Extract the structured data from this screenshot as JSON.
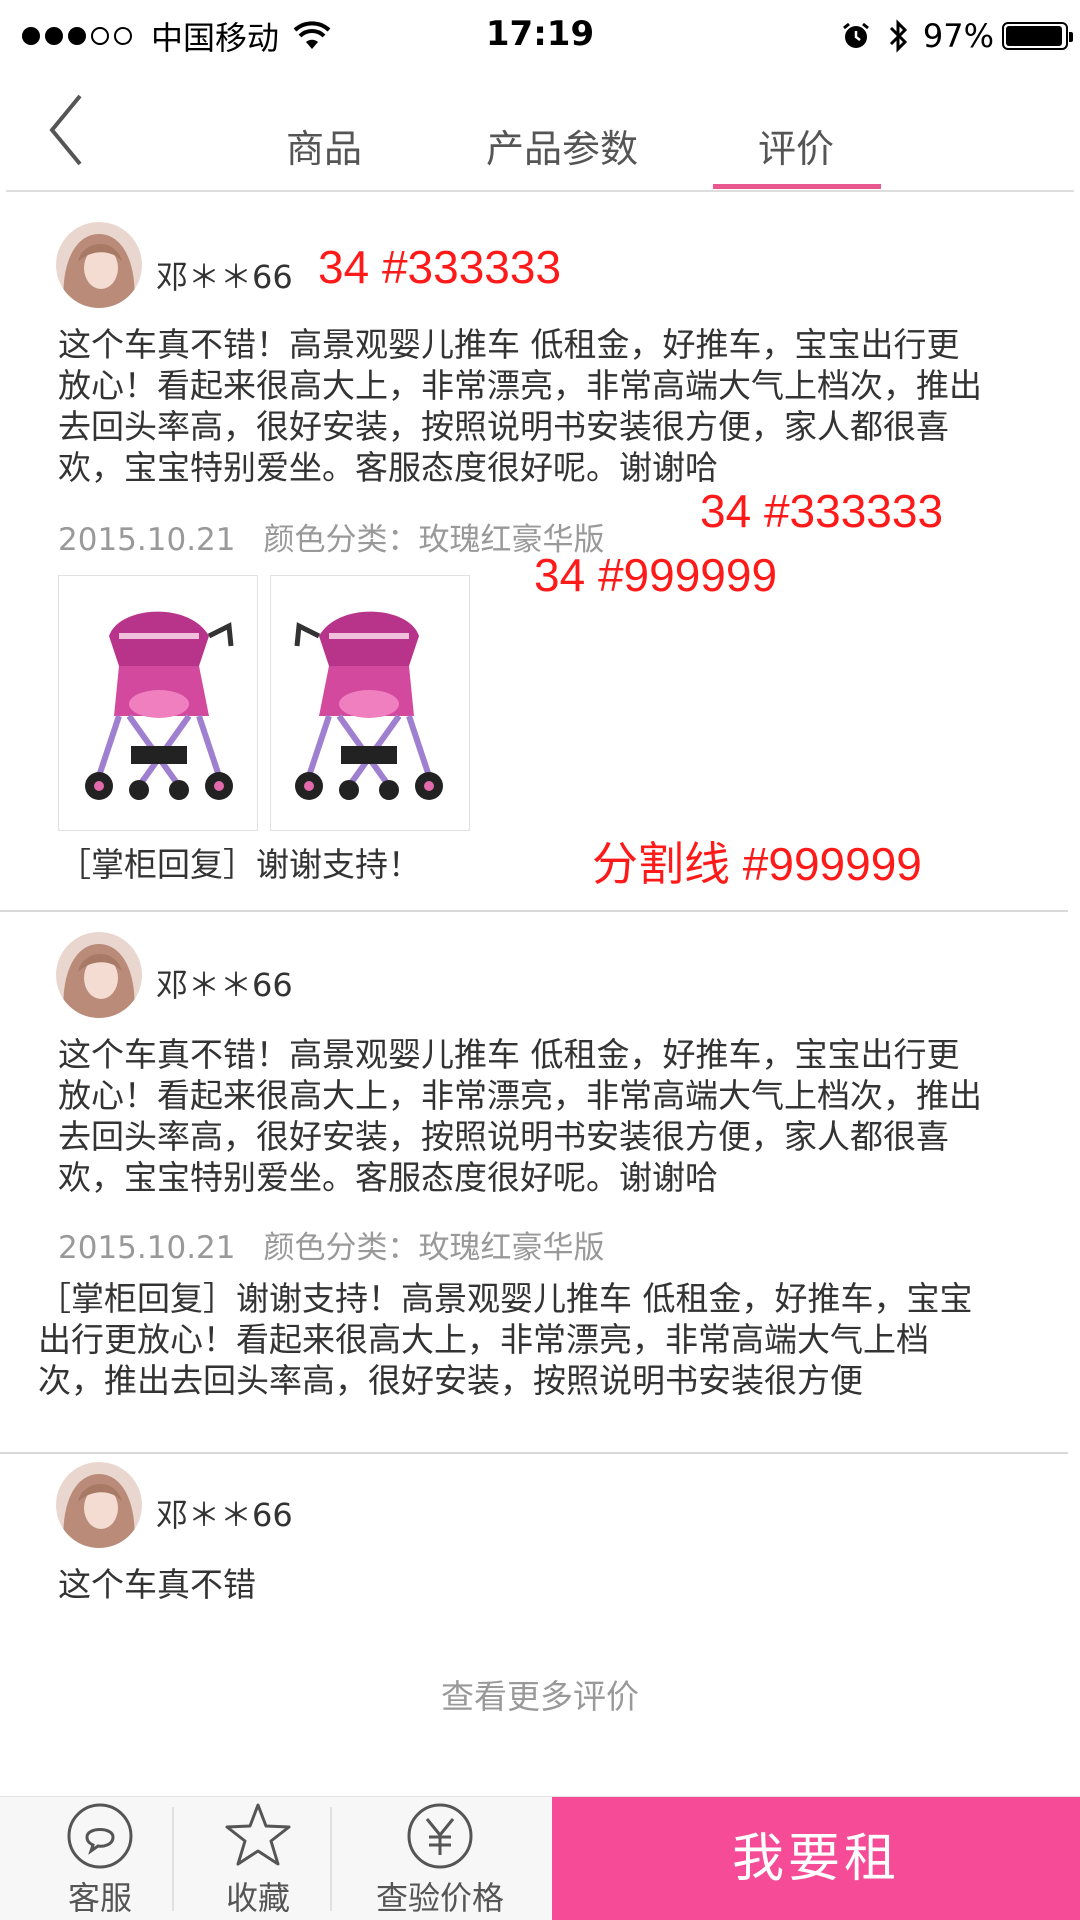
{
  "status_bar": {
    "carrier": "中国移动",
    "time": "17:19",
    "battery": "97%",
    "battery_level": 0.97
  },
  "nav": {
    "tabs": [
      {
        "label": "商品"
      },
      {
        "label": "产品参数"
      },
      {
        "label": "评价",
        "active": true
      }
    ],
    "accent_color": "#e8588e"
  },
  "reviews": [
    {
      "username": "邓＊＊66",
      "text": "这个车真不错！高景观婴儿推车 低租金，好推车，宝宝出行更放心！看起来很高大上，非常漂亮，非常高端大气上档次，推出去回头率高，很好安装，按照说明书安装很方便，家人都很喜欢，宝宝特别爱坐。客服态度很好呢。谢谢哈",
      "date": "2015.10.21",
      "variant": "颜色分类：玫瑰红豪华版",
      "reply": "［掌柜回复］谢谢支持！"
    },
    {
      "username": "邓＊＊66",
      "text": "这个车真不错！高景观婴儿推车 低租金，好推车，宝宝出行更放心！看起来很高大上，非常漂亮，非常高端大气上档次，推出去回头率高，很好安装，按照说明书安装很方便，家人都很喜欢，宝宝特别爱坐。客服态度很好呢。谢谢哈",
      "date": "2015.10.21",
      "variant": "颜色分类：玫瑰红豪华版",
      "reply": "［掌柜回复］谢谢支持！高景观婴儿推车 低租金，好推车，宝宝出行更放心！看起来很高大上，非常漂亮，非常高端大气上档次，推出去回头率高，很好安装，按照说明书安装很方便"
    },
    {
      "username": "邓＊＊66",
      "text": "这个车真不错"
    }
  ],
  "annotations": {
    "a1": "34 #333333",
    "a2": "34 #333333",
    "a3": "34 #999999",
    "a4": "分割线 #999999"
  },
  "more_reviews": "查看更多评价",
  "bottom_bar": {
    "service": "客服",
    "favorite": "收藏",
    "check_price": "查验价格",
    "rent": "我要租",
    "rent_color": "#f64b96"
  }
}
